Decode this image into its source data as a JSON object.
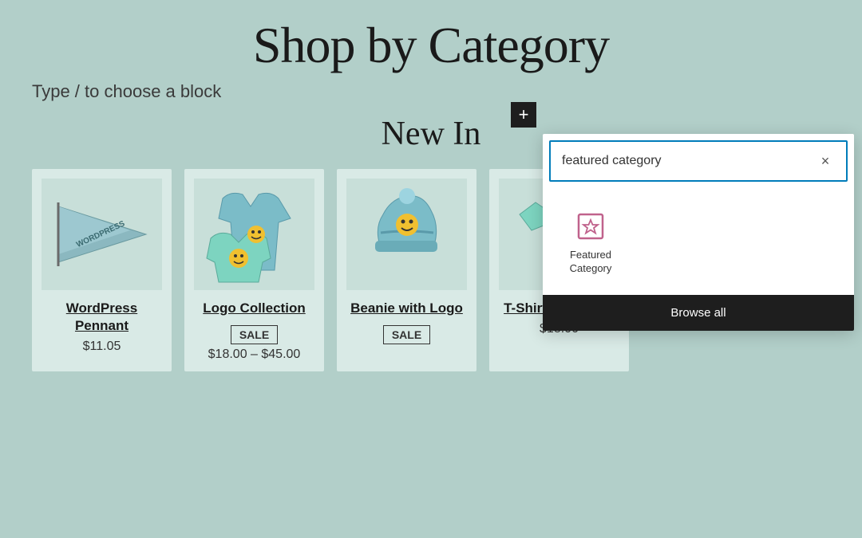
{
  "page": {
    "title": "Shop by Category",
    "hint": "Type / to choose a block",
    "section_title": "New In"
  },
  "products": [
    {
      "name": "WordPress Pennant",
      "price": "$11.05",
      "sale": false,
      "type": "pennant"
    },
    {
      "name": "Logo Collection",
      "price": "$18.00 – $45.00",
      "sale": true,
      "sale_label": "SALE",
      "type": "hoodie"
    },
    {
      "name": "Beanie with Logo",
      "price": "",
      "sale": true,
      "sale_label": "SALE",
      "type": "beanie"
    },
    {
      "name": "T-Shirt with Logo",
      "price": "$18.00",
      "sale": false,
      "type": "tshirt"
    }
  ],
  "add_block_btn": {
    "label": "+"
  },
  "block_search": {
    "placeholder": "featured category",
    "clear_label": "×",
    "result": {
      "label": "Featured Category"
    },
    "browse_all_label": "Browse all"
  },
  "colors": {
    "background": "#b2cfc9",
    "accent_blue": "#007cba",
    "dark": "#1e1e1e",
    "block_icon_color": "#c0628c"
  }
}
